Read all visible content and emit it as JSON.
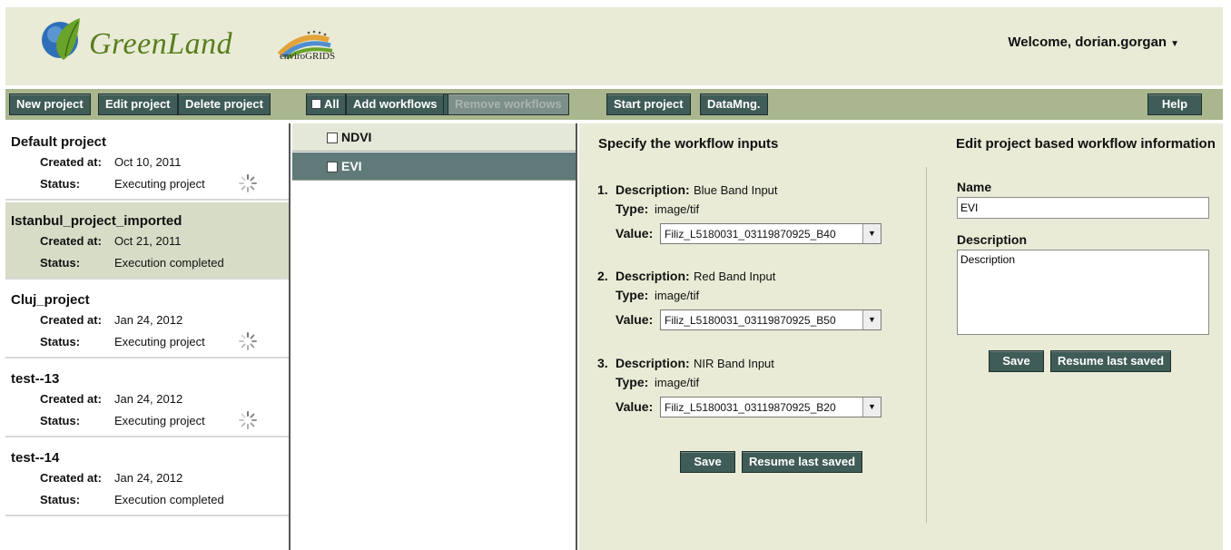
{
  "brand": {
    "logo_text": "GreenLand",
    "partner_logo_text": "enviroGRIDS"
  },
  "user": {
    "welcome": "Welcome, dorian.gorgan",
    "caret": "▼"
  },
  "toolbar": {
    "new_project": "New project",
    "edit_project": "Edit project",
    "delete_project": "Delete project",
    "all": "All",
    "add_workflows": "Add workflows",
    "remove_workflows": "Remove workflows",
    "start_project": "Start project",
    "datamng": "DataMng.",
    "help": "Help"
  },
  "labels": {
    "created_at": "Created at:",
    "status": "Status:"
  },
  "projects": [
    {
      "name": "Default project",
      "created": "Oct 10, 2011",
      "status": "Executing project",
      "spinner": true,
      "selected": false
    },
    {
      "name": "Istanbul_project_imported",
      "created": "Oct 21, 2011",
      "status": "Execution completed",
      "spinner": false,
      "selected": true
    },
    {
      "name": "Cluj_project",
      "created": "Jan 24, 2012",
      "status": "Executing project",
      "spinner": true,
      "selected": false
    },
    {
      "name": "test--13",
      "created": "Jan 24, 2012",
      "status": "Executing project",
      "spinner": true,
      "selected": false
    },
    {
      "name": "test--14",
      "created": "Jan 24, 2012",
      "status": "Execution completed",
      "spinner": false,
      "selected": false
    }
  ],
  "workflows": [
    {
      "label": "NDVI",
      "active": false
    },
    {
      "label": "EVI",
      "active": true
    }
  ],
  "inputs_panel": {
    "title": "Specify the workflow inputs",
    "description_label": "Description:",
    "type_label": "Type:",
    "value_label": "Value:",
    "items": [
      {
        "num": "1.",
        "description": "Blue Band Input",
        "type": "image/tif",
        "value": "Filiz_L5180031_03119870925_B40"
      },
      {
        "num": "2.",
        "description": "Red Band Input",
        "type": "image/tif",
        "value": "Filiz_L5180031_03119870925_B50"
      },
      {
        "num": "3.",
        "description": "NIR Band Input",
        "type": "image/tif",
        "value": "Filiz_L5180031_03119870925_B20"
      }
    ],
    "save": "Save",
    "resume": "Resume last saved"
  },
  "edit_panel": {
    "title": "Edit project based workflow information",
    "name_label": "Name",
    "name_value": "EVI",
    "description_label": "Description",
    "description_value": "Description",
    "save": "Save",
    "resume": "Resume last saved"
  },
  "colors": {
    "header_bg": "#e9ebd6",
    "toolbar_bg": "#a9b68e",
    "button_bg": "#3f5c57",
    "selected_row": "#d6dcc6",
    "active_workflow": "#5f7a78",
    "logo_green": "#587e1e"
  }
}
